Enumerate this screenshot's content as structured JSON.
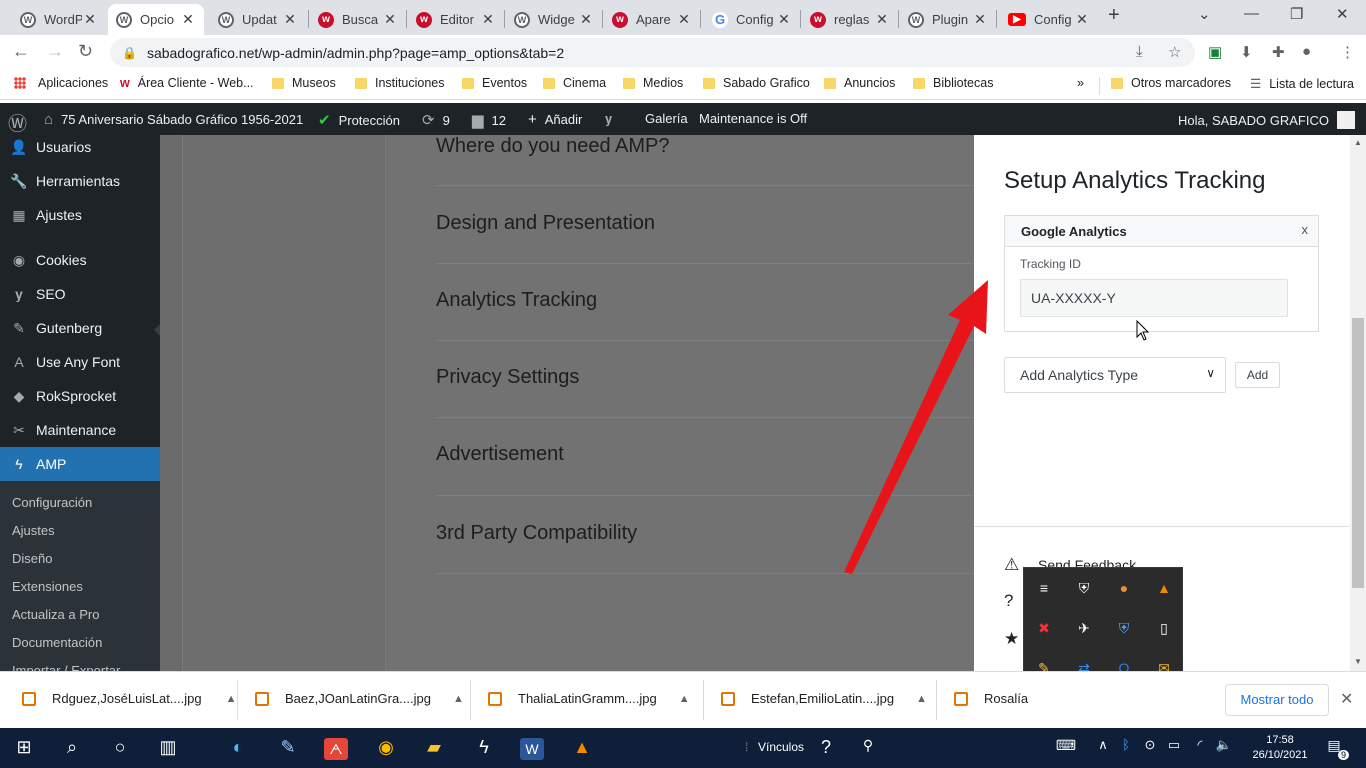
{
  "browser": {
    "tabs": [
      {
        "title": "WordP",
        "icon": "wordpress-icon"
      },
      {
        "title": "Opcio",
        "icon": "wordpress-icon"
      },
      {
        "title": "Updat",
        "icon": "wordpress-icon"
      },
      {
        "title": "Busca",
        "icon": "red-w-icon"
      },
      {
        "title": "Editor",
        "icon": "red-w-icon"
      },
      {
        "title": "Widge",
        "icon": "wordpress-icon"
      },
      {
        "title": "Apare",
        "icon": "red-w-icon"
      },
      {
        "title": "Config",
        "icon": "google-icon"
      },
      {
        "title": "reglas",
        "icon": "red-w-icon"
      },
      {
        "title": "Plugin",
        "icon": "wordpress-icon"
      },
      {
        "title": "Config",
        "icon": "youtube-icon"
      }
    ],
    "url": "sabadografico.net/wp-admin/admin.php?page=amp_options&tab=2",
    "bookmarks": [
      "Aplicaciones",
      "Área Cliente - Web...",
      "Museos",
      "Instituciones",
      "Eventos",
      "Cinema",
      "Medios",
      "Sabado Grafico",
      "Anuncios",
      "Bibliotecas"
    ],
    "bookmarks_more": "»",
    "other_bookmarks": "Otros marcadores",
    "reading_list": "Lista de lectura"
  },
  "adminbar": {
    "site": "75 Aniversario Sábado Gráfico 1956-2021",
    "protection": "Protección",
    "updates": "9",
    "comments": "12",
    "add_new": "Añadir",
    "gallery": "Galería",
    "maintenance": "Maintenance is Off",
    "greeting": "Hola, SABADO GRAFICO"
  },
  "sidebar": {
    "items": [
      "Usuarios",
      "Herramientas",
      "Ajustes",
      "Cookies",
      "SEO",
      "Gutenberg",
      "Use Any Font",
      "RokSprocket",
      "Maintenance",
      "AMP"
    ],
    "submenu": [
      "Configuración",
      "Ajustes",
      "Diseño",
      "Extensiones",
      "Actualiza a Pro",
      "Documentación",
      "Importar / Exportar"
    ]
  },
  "main": {
    "sections": [
      "Where do you need AMP?",
      "Design and Presentation",
      "Analytics Tracking",
      "Privacy Settings",
      "Advertisement",
      "3rd Party Compatibility"
    ]
  },
  "panel": {
    "title": "Setup Analytics Tracking",
    "ga_header": "Google Analytics",
    "ga_close": "x",
    "tracking_label": "Tracking ID",
    "tracking_value": "UA-XXXXX-Y",
    "select_value": "Add Analytics Type",
    "add_button": "Add",
    "feedback": "Send Feedback"
  },
  "downloads": {
    "files": [
      "Rdguez,JoséLuisLat....jpg",
      "Baez,JOanLatinGra....jpg",
      "ThaliaLatinGramm....jpg",
      "Estefan,EmilioLatin....jpg",
      "Rosalía"
    ],
    "show_all": "Mostrar todo"
  },
  "taskbar": {
    "links_label": "Vínculos",
    "time": "17:58",
    "date": "26/10/2021",
    "notifications": "9"
  },
  "colors": {
    "wp_admin_bar": "#1d2327",
    "wp_accent": "#2271b1",
    "arrow_red": "#e8141a",
    "taskbar": "#0f1f3a"
  }
}
